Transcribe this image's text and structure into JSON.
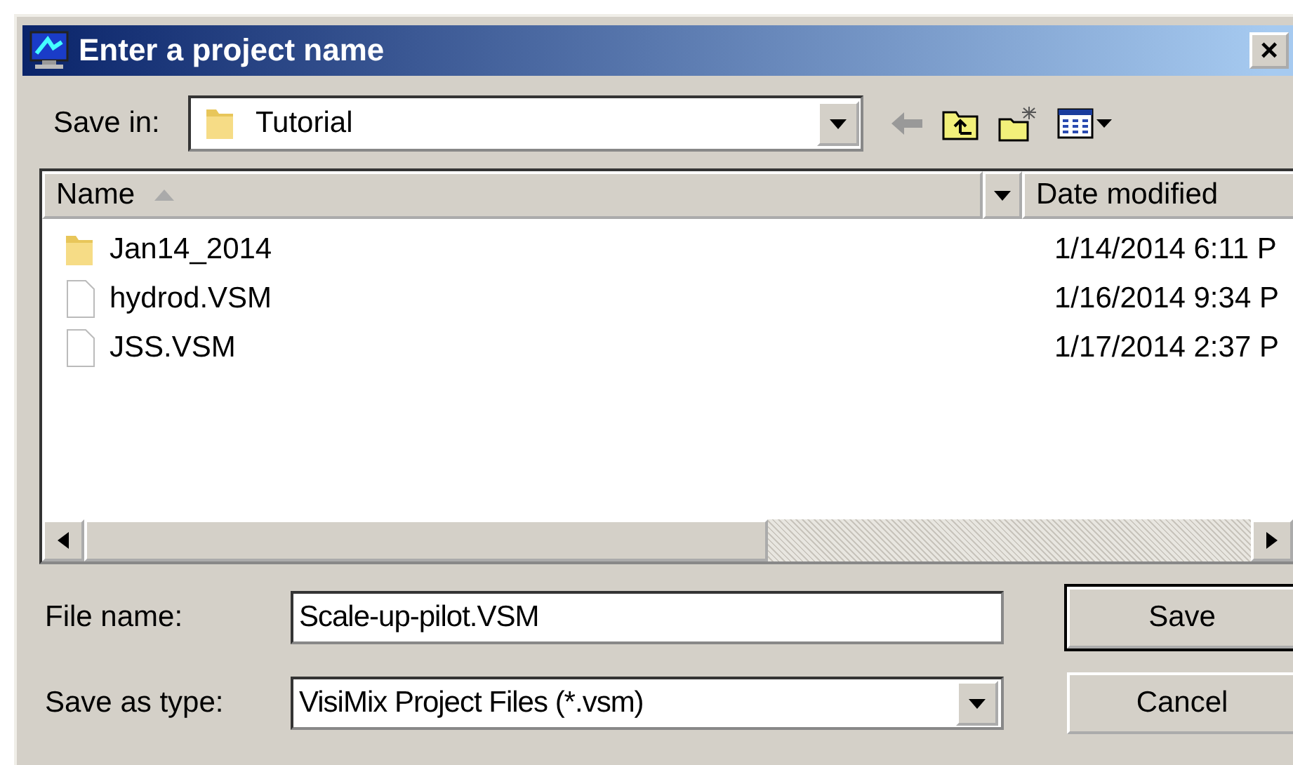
{
  "window": {
    "title": "Enter a project name",
    "close": "×"
  },
  "save_in": {
    "label": "Save in:",
    "value": "Tutorial"
  },
  "columns": [
    {
      "label": "Name",
      "sorted": true
    },
    {
      "label": "Date modified",
      "sorted": false
    }
  ],
  "rows": [
    {
      "kind": "folder",
      "name": "Jan14_2014",
      "date": "1/14/2014 6:11 P"
    },
    {
      "kind": "file",
      "name": "hydrod.VSM",
      "date": "1/16/2014 9:34 P"
    },
    {
      "kind": "file",
      "name": "JSS.VSM",
      "date": "1/17/2014 2:37 P"
    }
  ],
  "file_name": {
    "label": "File name:",
    "value": "Scale-up-pilot.VSM"
  },
  "save_as_type": {
    "label": "Save as type:",
    "value": "VisiMix Project Files (*.vsm)"
  },
  "buttons": [
    "Save",
    "Cancel"
  ]
}
